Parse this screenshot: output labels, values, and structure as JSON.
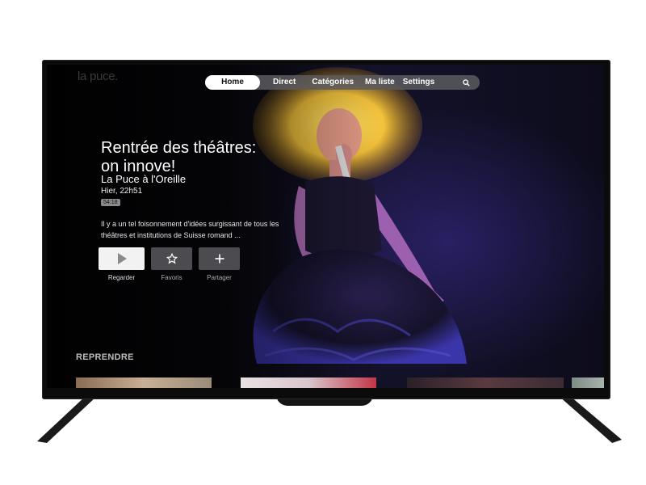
{
  "app": {
    "logo_text": "la puce",
    "logo_dot": "."
  },
  "nav": {
    "items": [
      {
        "label": "Home",
        "active": true
      },
      {
        "label": "Direct"
      },
      {
        "label": "Catégories"
      },
      {
        "label": "Ma liste"
      },
      {
        "label": "Settings"
      }
    ],
    "search_icon": "search-icon"
  },
  "hero": {
    "title_line1": "Rentrée des théâtres:",
    "title_line2": "on innove!",
    "subtitle": "La Puce à l'Oreille",
    "date": "Hier, 22h51",
    "duration": "54:18",
    "description_line1": "Il y a un tel foisonnement d'idées surgissant de tous les",
    "description_line2": "théâtres et institutions de Suisse romand ..."
  },
  "actions": {
    "play_label": "Regarder",
    "favorites_label": "Favoris",
    "share_label": "Partager"
  },
  "rows": {
    "resume_title": "REPRENDRE"
  },
  "colors": {
    "accent": "#7a1420",
    "nav_bg": "#5a5a5f",
    "button_dark": "#4c4c50"
  }
}
